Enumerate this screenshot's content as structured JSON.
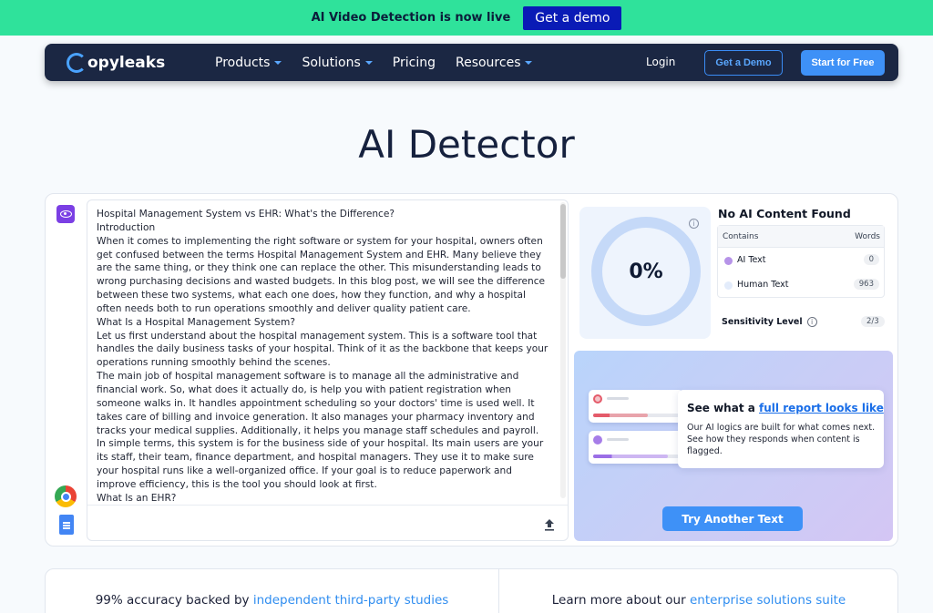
{
  "banner": {
    "text": "AI Video Detection is now live",
    "button": "Get a demo"
  },
  "nav": {
    "logo": "opyleaks",
    "items": [
      {
        "label": "Products",
        "has_caret": true
      },
      {
        "label": "Solutions",
        "has_caret": true
      },
      {
        "label": "Pricing",
        "has_caret": false
      },
      {
        "label": "Resources",
        "has_caret": true
      }
    ],
    "login": "Login",
    "get_demo": "Get a Demo",
    "start_free": "Start for Free"
  },
  "page_title": "AI Detector",
  "document_text": [
    "Hospital Management System vs EHR: What's the Difference?",
    "Introduction",
    "When it comes to implementing the right software or system for your hospital, owners often get confused between the terms Hospital Management System and EHR. Many believe they are the same thing, or they think one can replace the other. This misunderstanding leads to wrong purchasing decisions and wasted budgets. In this blog post, we will see the difference between these two systems, what each one does, how they function, and why a hospital often needs both to run operations smoothly and deliver quality patient care.",
    "What Is a Hospital Management System?",
    "Let us first understand about the hospital management system. This is a software tool that handles the daily business tasks of your hospital. Think of it as the backbone that keeps your operations running smoothly behind the scenes.",
    "The main job of hospital management software is to manage all the administrative and financial work. So, what does it actually do, is help you with patient registration when someone walks in. It handles appointment scheduling so your doctors' time is used well. It takes care of billing and invoice generation. It also manages your pharmacy inventory and tracks your medical supplies. Additionally, it helps you manage staff schedules and payroll.",
    "In simple terms, this system is for the business side of your hospital. Its main users are your its staff, their team, finance department, and hospital managers. They use it to make sure your hospital runs like a well-organized office. If your goal is to reduce paperwork and improve efficiency, this is the tool you should look at first.",
    "What Is an EHR?"
  ],
  "result": {
    "percent": "0%",
    "title": "No AI Content Found",
    "col_contains": "Contains",
    "col_words": "Words",
    "rows": [
      {
        "label": "AI Text",
        "value": "0",
        "color": "#b693e8"
      },
      {
        "label": "Human Text",
        "value": "963",
        "color": "#e3ecfb"
      }
    ],
    "sensitivity_label": "Sensitivity Level",
    "sensitivity_value": "2/3"
  },
  "promo": {
    "title_prefix": "See what a",
    "title_link": "full report looks like",
    "description": "Our AI logics are built for what comes next. See how they responds when content is flagged.",
    "button": "Try Another Text"
  },
  "bottom": {
    "left_prefix": "99% accuracy backed by",
    "left_link": "independent third-party studies",
    "right_prefix": "Learn more about our",
    "right_link": "enterprise solutions suite"
  },
  "colors": {
    "banner": "#2fe29b",
    "nav": "#1b2743",
    "accent": "#3e91f7",
    "purple": "#7b3fe4"
  }
}
